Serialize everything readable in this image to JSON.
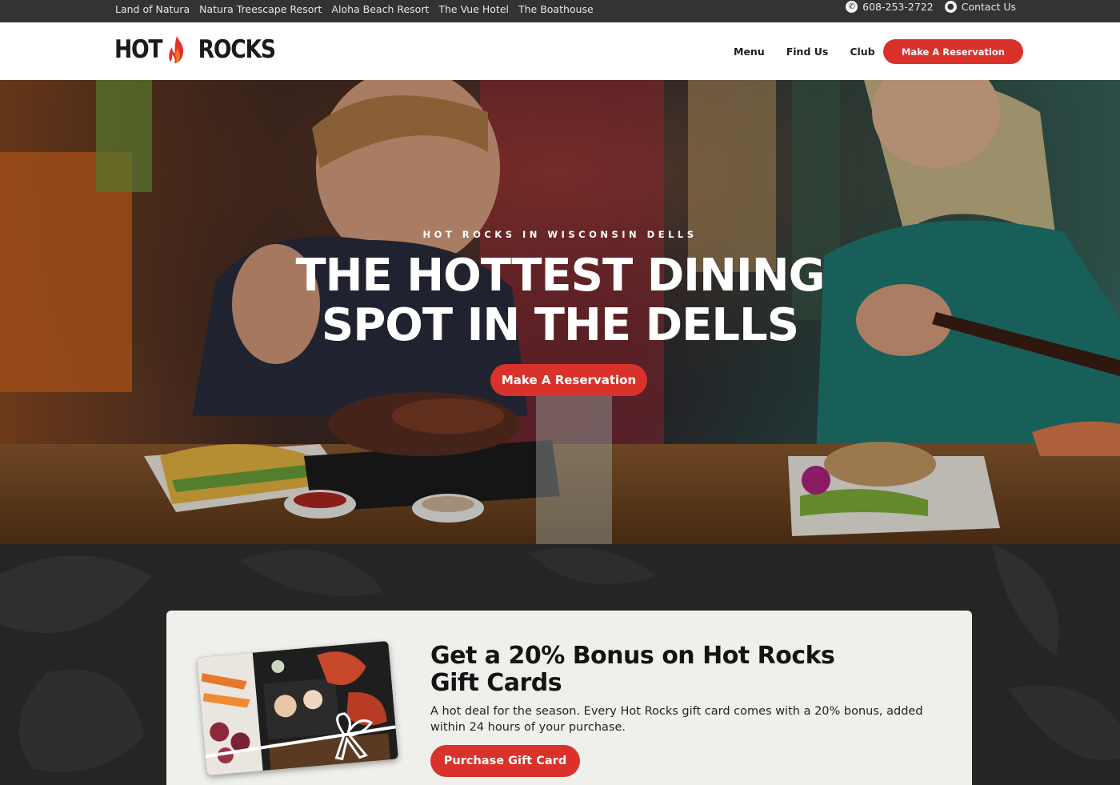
{
  "topbar": {
    "links": [
      "Land of Natura",
      "Natura Treescape Resort",
      "Aloha Beach Resort",
      "The Vue Hotel",
      "The Boathouse"
    ],
    "phone": "608-253-2722",
    "contact": "Contact Us",
    "phone_icon": "phone-icon",
    "contact_icon": "chat-icon"
  },
  "header": {
    "logo_left": "HOT",
    "logo_right": "ROCKS",
    "logo_icon": "flame-icon",
    "nav": [
      "Menu",
      "Find Us",
      "Club"
    ],
    "cta": "Make A Reservation"
  },
  "hero": {
    "eyebrow": "HOT ROCKS IN WISCONSIN DELLS",
    "title_line1": "THE HOTTEST DINING",
    "title_line2": "SPOT IN THE DELLS",
    "cta": "Make A Reservation"
  },
  "promo": {
    "title": "Get a 20% Bonus on Hot Rocks Gift Cards",
    "body": "A hot deal for the season. Every Hot Rocks gift card comes with a 20% bonus, added within 24 hours of your purchase.",
    "cta": "Purchase Gift Card"
  },
  "colors": {
    "accent": "#d9322a",
    "topbar": "#333333",
    "dark": "#252525",
    "card": "#efefec"
  }
}
